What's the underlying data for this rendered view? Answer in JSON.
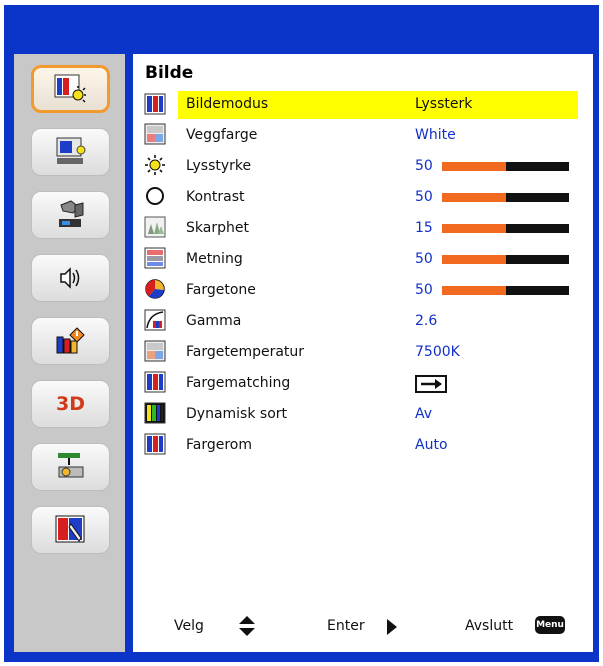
{
  "colors": {
    "frame": "#0b34c9",
    "accent": "#f26a1f",
    "highlight": "#ffff00",
    "value_text": "#1230c8"
  },
  "sidebar": {
    "items": [
      {
        "name": "picture-icon"
      },
      {
        "name": "display-icon"
      },
      {
        "name": "setup-icon"
      },
      {
        "name": "audio-icon"
      },
      {
        "name": "options-icon"
      },
      {
        "name": "3d",
        "label": "3D"
      },
      {
        "name": "network-icon"
      },
      {
        "name": "interactive-icon"
      }
    ]
  },
  "main": {
    "title": "Bilde",
    "rows": [
      {
        "label": "Bildemodus",
        "value": "Lyssterk"
      },
      {
        "label": "Veggfarge",
        "value": "White"
      },
      {
        "label": "Lysstyrke",
        "value": "50",
        "level": 0.5
      },
      {
        "label": "Kontrast",
        "value": "50",
        "level": 0.5
      },
      {
        "label": "Skarphet",
        "value": "15",
        "level": 0.5
      },
      {
        "label": "Metning",
        "value": "50",
        "level": 0.5
      },
      {
        "label": "Fargetone",
        "value": "50",
        "level": 0.5
      },
      {
        "label": "Gamma",
        "value": "2.6"
      },
      {
        "label": "Fargetemperatur",
        "value": "7500K"
      },
      {
        "label": "Fargematching",
        "value": ""
      },
      {
        "label": "Dynamisk sort",
        "value": "Av"
      },
      {
        "label": "Fargerom",
        "value": "Auto"
      }
    ]
  },
  "footer": {
    "select_label": "Velg",
    "enter_label": "Enter",
    "exit_label": "Avslutt",
    "menu_badge": "Menu"
  }
}
